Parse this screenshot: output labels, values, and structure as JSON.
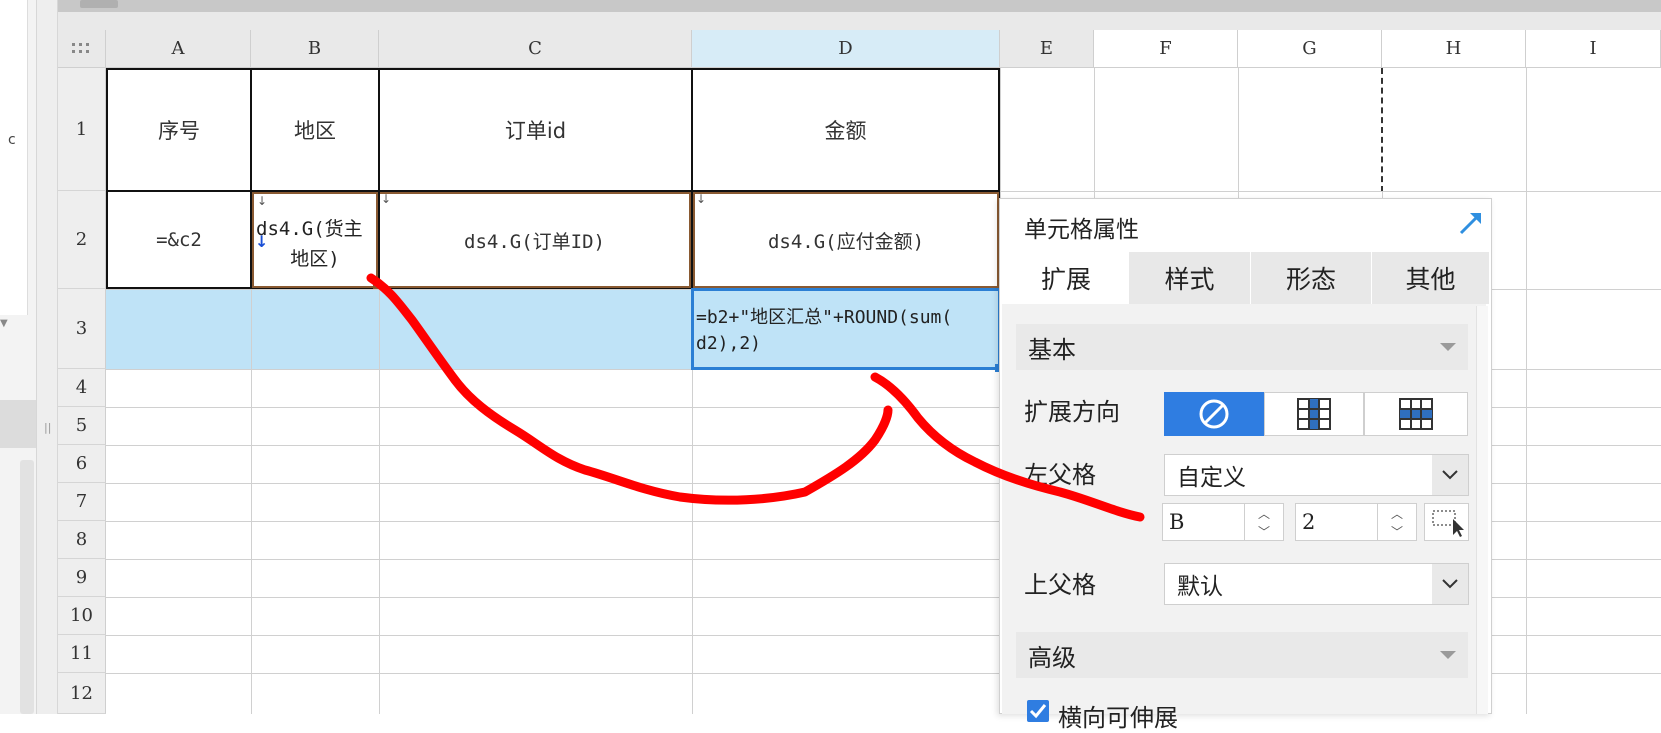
{
  "columns": [
    "A",
    "B",
    "C",
    "D",
    "E",
    "F",
    "G",
    "H",
    "I"
  ],
  "rows": [
    "1",
    "2",
    "3",
    "4",
    "5",
    "6",
    "7",
    "8",
    "9",
    "10",
    "11",
    "12"
  ],
  "cells": {
    "a1": "序号",
    "b1": "地区",
    "c1": "订单id",
    "d1": "金额",
    "a2": "=&c2",
    "b2_line1": "ds4.G(货主",
    "b2_line2": "地区)",
    "c2": "ds4.G(订单ID)",
    "d2": "ds4.G(应付金额)",
    "d3_line1": "=b2+\"地区汇总\"+ROUND(sum(",
    "d3_line2": "d2),2)"
  },
  "left_edge_text": "c",
  "panel": {
    "title": "单元格属性",
    "tabs": [
      "扩展",
      "样式",
      "形态",
      "其他"
    ],
    "active_tab": "扩展",
    "section_basic": "基本",
    "expand_direction_label": "扩展方向",
    "left_parent_label": "左父格",
    "left_parent_value": "自定义",
    "left_parent_col": "B",
    "left_parent_row": "2",
    "top_parent_label": "上父格",
    "top_parent_value": "默认",
    "section_advanced": "高级",
    "checkbox_label": "横向可伸展"
  },
  "colors": {
    "selection_fill": "#bfe3f7",
    "selection_border": "#2b7fd4",
    "highlight_border": "#8a5a32",
    "annotation_red": "#ff0000",
    "active_segment": "#2f7de1"
  }
}
